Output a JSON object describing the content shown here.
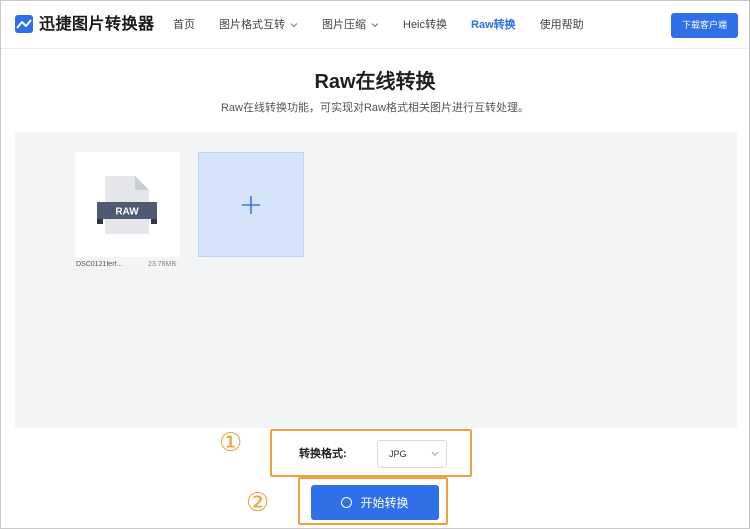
{
  "header": {
    "brand": "迅捷图片转换器",
    "nav": [
      {
        "label": "首页",
        "dropdown": false,
        "active": false
      },
      {
        "label": "图片格式互转",
        "dropdown": true,
        "active": false
      },
      {
        "label": "图片压缩",
        "dropdown": true,
        "active": false
      },
      {
        "label": "Heic转换",
        "dropdown": false,
        "active": false
      },
      {
        "label": "Raw转换",
        "dropdown": false,
        "active": true
      },
      {
        "label": "使用帮助",
        "dropdown": false,
        "active": false
      }
    ],
    "download_label": "下载客户端"
  },
  "page": {
    "title": "Raw在线转换",
    "subtitle": "Raw在线转换功能，可实现对Raw格式相关图片进行互转处理。"
  },
  "file": {
    "badge": "RAW",
    "name": "DSC0121ferf...",
    "size": "23.78MB"
  },
  "format": {
    "label": "转换格式:",
    "selected": "JPG"
  },
  "start_label": "开始转换",
  "callouts": {
    "one": "①",
    "two": "②"
  },
  "colors": {
    "accent": "#2f6fe8",
    "callout": "#f0a043",
    "add_tile": "#d5e3fb"
  }
}
